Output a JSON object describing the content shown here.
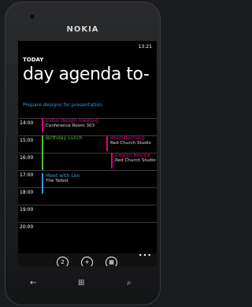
{
  "device": {
    "brand": "NOKIA"
  },
  "status": {
    "time": "13:21"
  },
  "header": {
    "today": "TODAY",
    "pivot_title": "day agenda to-"
  },
  "task": "Prepare designs for presentation",
  "hours": [
    "14:00",
    "15:00",
    "16:00",
    "17:00",
    "18:00",
    "19:00",
    "20:00"
  ],
  "events": [
    {
      "title": "Initial design meeting",
      "subtitle": "Conference Room 303",
      "color": "#e3007a"
    },
    {
      "title": "Birthday Lunch",
      "subtitle": "",
      "color": "#4fbf2f"
    },
    {
      "title": "Brainstorming",
      "subtitle": "Red Church Studio",
      "color": "#e3007a"
    },
    {
      "title": "Design Review",
      "subtitle": "Red Church Studio",
      "color": "#e3007a"
    },
    {
      "title": "Meet with Leo",
      "subtitle": "The Talbot",
      "color": "#2e9bd8"
    }
  ],
  "appbar": {
    "date_badge": "2",
    "more": "•••"
  },
  "softkeys": {
    "back": "←",
    "start": "⊞",
    "search": "⌕"
  }
}
